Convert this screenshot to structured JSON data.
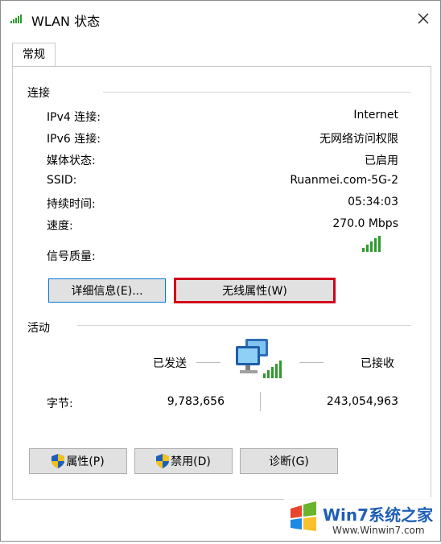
{
  "window": {
    "title": "WLAN 状态"
  },
  "tabs": [
    {
      "label": "常规"
    }
  ],
  "connection": {
    "section_label": "连接",
    "rows": [
      {
        "label": "IPv4 连接:",
        "value": "Internet"
      },
      {
        "label": "IPv6 连接:",
        "value": "无网络访问权限"
      },
      {
        "label": "媒体状态:",
        "value": "已启用"
      },
      {
        "label": "SSID:",
        "value": "Ruanmei.com-5G-2"
      },
      {
        "label": "持续时间:",
        "value": "05:34:03"
      },
      {
        "label": "速度:",
        "value": "270.0 Mbps"
      }
    ],
    "signal_label": "信号质量:",
    "signal_bars": 5,
    "details_button": "详细信息(E)...",
    "wireless_props_button": "无线属性(W)"
  },
  "activity": {
    "section_label": "活动",
    "sent_label": "已发送",
    "received_label": "已接收",
    "bytes_label": "字节:",
    "bytes_sent": "9,783,656",
    "bytes_received": "243,054,963"
  },
  "buttons": {
    "properties": "属性(P)",
    "disable": "禁用(D)",
    "diagnose": "诊断(G)"
  },
  "watermark": {
    "brand": "Win7系统之家",
    "url": "Www.Winwin7.com"
  },
  "colors": {
    "highlight_border": "#d0021b",
    "signal_green": "#2e9a2e",
    "accent": "#0078d7"
  }
}
